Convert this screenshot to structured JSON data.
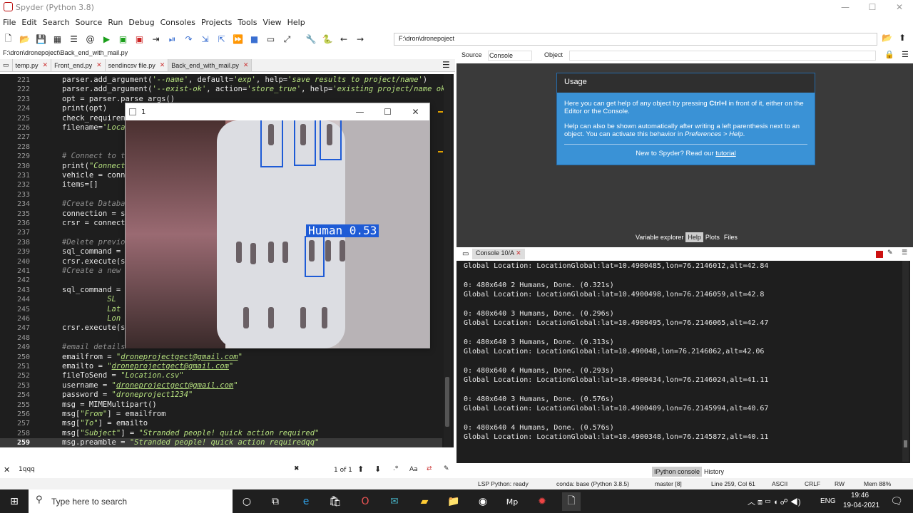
{
  "window": {
    "title": "Spyder (Python 3.8)"
  },
  "menu": [
    "File",
    "Edit",
    "Search",
    "Source",
    "Run",
    "Debug",
    "Consoles",
    "Projects",
    "Tools",
    "View",
    "Help"
  ],
  "toolbar": {
    "path": "F:\\dron\\dronepoject"
  },
  "editor": {
    "current_file": "F:\\dron\\dronepoject\\Back_end_with_mail.py",
    "tabs": [
      "temp.py",
      "Front_end.py",
      "sendincsv file.py",
      "Back_end_with_mail.py"
    ],
    "active_tab": 3,
    "lines": [
      {
        "n": "221",
        "html": "parser.add_argument(<s>'--name'</s>, default=<s>'exp'</s>, help=<s>'save results to project/name'</s>)"
      },
      {
        "n": "222",
        "html": "parser.add_argument(<s>'--exist-ok'</s>, action=<s>'store_true'</s>, help=<s>'existing project/name ok, d</s>"
      },
      {
        "n": "223",
        "html": "opt = parser.parse_args()"
      },
      {
        "n": "224",
        "html": "print(opt)"
      },
      {
        "n": "225",
        "html": "check_requireme"
      },
      {
        "n": "226",
        "html": "filename=<s>'Locat</s>"
      },
      {
        "n": "227",
        "html": ""
      },
      {
        "n": "228",
        "html": ""
      },
      {
        "n": "229",
        "html": "<c># Connect to th</c>"
      },
      {
        "n": "230",
        "html": "print(<s>\"Connecti</s>"
      },
      {
        "n": "231",
        "html": "vehicle = conne"
      },
      {
        "n": "232",
        "html": "items=[]"
      },
      {
        "n": "233",
        "html": ""
      },
      {
        "n": "234",
        "html": "<c>#Create Databas</c>"
      },
      {
        "n": "235",
        "html": "connection = sq"
      },
      {
        "n": "236",
        "html": "crsr = connecti"
      },
      {
        "n": "237",
        "html": ""
      },
      {
        "n": "238",
        "html": "<c>#Delete previou</c>"
      },
      {
        "n": "239",
        "html": "sql_command = "
      },
      {
        "n": "240",
        "html": "crsr.execute(sq"
      },
      {
        "n": "241",
        "html": "<c>#Create a new t</c>"
      },
      {
        "n": "242",
        "html": ""
      },
      {
        "n": "243",
        "html": "sql_command = <s>\"</s>"
      },
      {
        "n": "244",
        "html": "          <s>SL</s>"
      },
      {
        "n": "245",
        "html": "          <s>Lat</s>"
      },
      {
        "n": "246",
        "html": "          <s>Lon</s>"
      },
      {
        "n": "247",
        "html": "crsr.execute(sq"
      },
      {
        "n": "248",
        "html": ""
      },
      {
        "n": "249",
        "html": "<c>#email details</c>"
      },
      {
        "n": "250",
        "html": "emailfrom = <s>\"<u>droneprojectgect@gmail.com</u>\"</s>"
      },
      {
        "n": "251",
        "html": "emailto = <s>\"<u>droneprojectgect@gmail.com</u>\"</s>"
      },
      {
        "n": "252",
        "html": "fileToSend = <s>\"Location.csv\"</s>"
      },
      {
        "n": "253",
        "html": "username = <s>\"<u>droneprojectgect@gmail.com</u>\"</s>"
      },
      {
        "n": "254",
        "html": "password = <s>\"droneproject1234\"</s>"
      },
      {
        "n": "255",
        "html": "msg = MIMEMultipart()"
      },
      {
        "n": "256",
        "html": "msg[<s>\"From\"</s>] = emailfrom"
      },
      {
        "n": "257",
        "html": "msg[<s>\"To\"</s>] = emailto"
      },
      {
        "n": "258",
        "html": "msg[<s>\"Subject\"</s>] = <s>\"Stranded people! quick action required\"</s>"
      },
      {
        "n": "259",
        "html": "msg.preamble = <s>\"Stranded people! quick action requiredqq\"</s>"
      }
    ],
    "current_line": "259"
  },
  "popup": {
    "title": "1",
    "detection_label": "Human 0.53"
  },
  "help": {
    "source_label": "Source",
    "source_value": "Console",
    "object_label": "Object",
    "usage_title": "Usage",
    "p1_a": "Here you can get help of any object by pressing ",
    "p1_b": "Ctrl+I",
    "p1_c": " in front of it, either on the Editor or the Console.",
    "p2_a": "Help can also be shown automatically after writing a left parenthesis next to an object. You can activate this behavior in ",
    "p2_b": "Preferences > Help",
    "p2_c": ".",
    "new_a": "New to Spyder? Read our ",
    "new_b": "tutorial",
    "tabs": [
      "Variable explorer",
      "Help",
      "Plots",
      "Files"
    ],
    "active_tab": 1
  },
  "console": {
    "tab": "Console 10/A",
    "lines": [
      "Global Location: LocationGlobal:lat=10.4900485,lon=76.2146012,alt=42.84",
      "",
      "0: 480x640 2 Humans, Done. (0.321s)",
      "Global Location: LocationGlobal:lat=10.4900498,lon=76.2146059,alt=42.8",
      "",
      "0: 480x640 3 Humans, Done. (0.296s)",
      "Global Location: LocationGlobal:lat=10.4900495,lon=76.2146065,alt=42.47",
      "",
      "0: 480x640 3 Humans, Done. (0.313s)",
      "Global Location: LocationGlobal:lat=10.490048,lon=76.2146062,alt=42.06",
      "",
      "0: 480x640 4 Humans, Done. (0.293s)",
      "Global Location: LocationGlobal:lat=10.4900434,lon=76.2146024,alt=41.11",
      "",
      "0: 480x640 3 Humans, Done. (0.576s)",
      "Global Location: LocationGlobal:lat=10.4900409,lon=76.2145994,alt=40.67",
      "",
      "0: 480x640 4 Humans, Done. (0.576s)",
      "Global Location: LocationGlobal:lat=10.4900348,lon=76.2145872,alt=40.11"
    ],
    "bottom_tabs": [
      "IPython console",
      "History"
    ],
    "active_bottom": 0
  },
  "find": {
    "value": "1qqq",
    "count": "1 of 1"
  },
  "status": {
    "lsp": "LSP Python: ready",
    "conda": "conda: base (Python 3.8.5)",
    "git": "master [8]",
    "pos": "Line 259, Col 61",
    "enc": "ASCII",
    "eol": "CRLF",
    "rw": "RW",
    "mem": "Mem 88%"
  },
  "taskbar": {
    "search_placeholder": "Type here to search",
    "lang": "ENG",
    "time": "19:46",
    "date": "19-04-2021"
  }
}
